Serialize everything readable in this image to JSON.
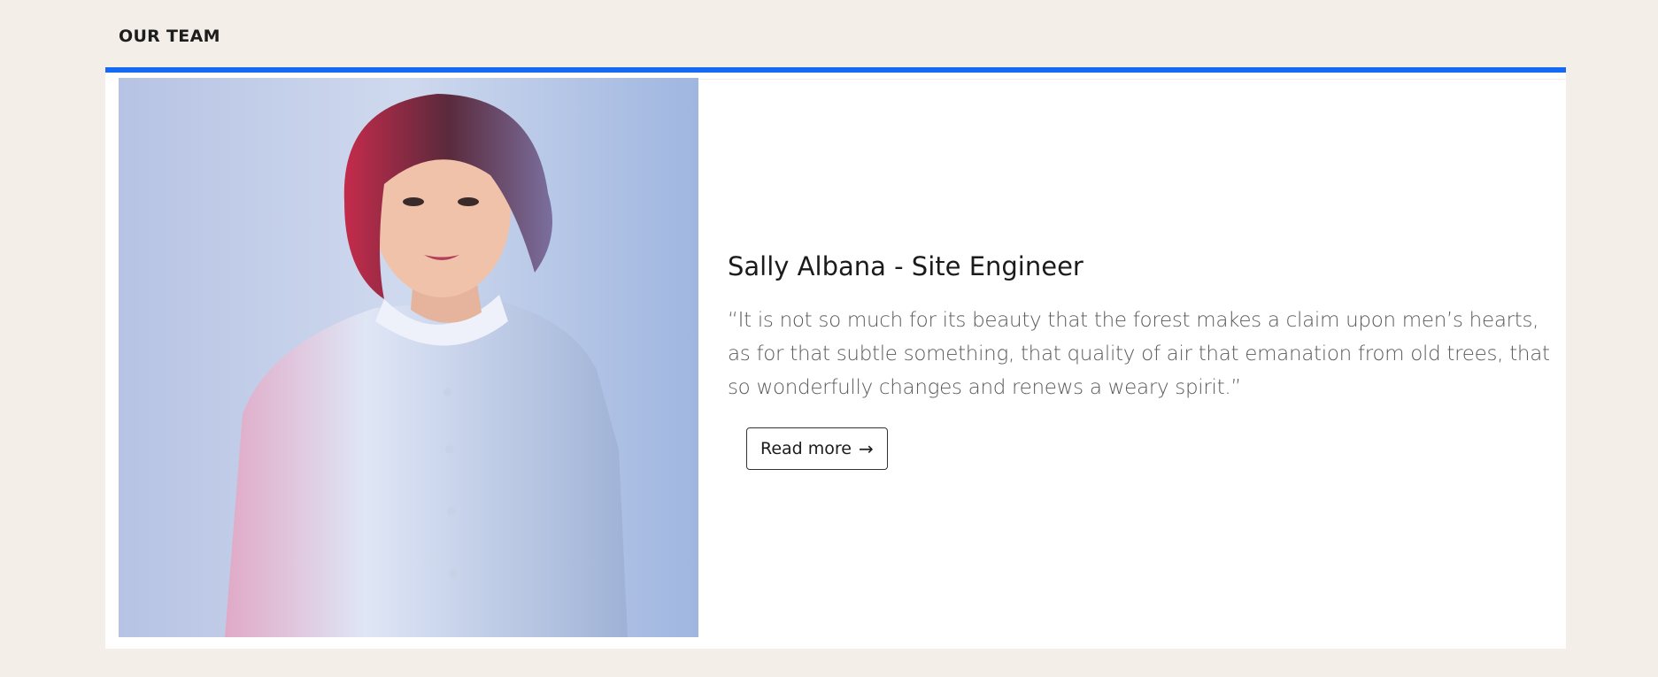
{
  "section": {
    "title": "OUR TEAM"
  },
  "member": {
    "name": "Sally Albana - Site Engineer",
    "quote": "“It is not so much for its beauty that the forest makes a claim upon men’s hearts, as for that subtle something, that quality of air that emanation from old trees, that so wonderfully changes and renews a weary spirit.”",
    "read_more_label": "Read more",
    "read_more_icon": "arrow-right-icon"
  },
  "colors": {
    "accent": "#1768f2",
    "page_background": "#f3eee8",
    "card_background": "#ffffff",
    "photo_background": "#c6d2ea"
  }
}
